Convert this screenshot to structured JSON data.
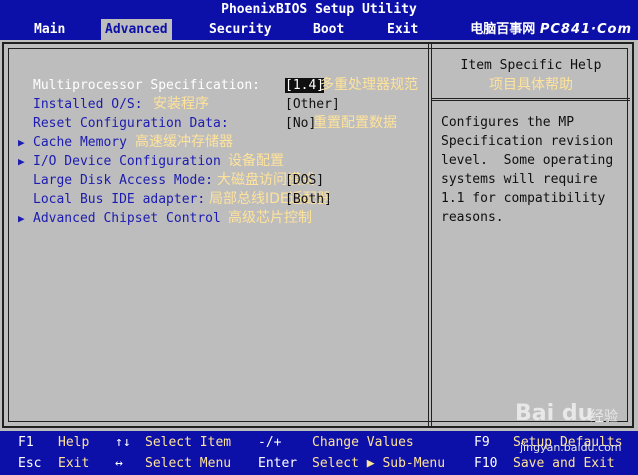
{
  "title": "PhoenixBIOS Setup Utility",
  "menu": {
    "tabs": [
      "Main",
      "Advanced",
      "Security",
      "Boot",
      "Exit"
    ],
    "active": "Advanced",
    "watermark_cn": "电脑百事网",
    "watermark_brand": "PC841·Com"
  },
  "items": [
    {
      "label": "Multiprocessor Specification:",
      "value": "[1.4]",
      "note_cn": "多重处理器规范",
      "submenu": false
    },
    {
      "label": "Installed O/S:",
      "note_cn": "安装程序",
      "value": "[Other]",
      "submenu": false
    },
    {
      "label": "Reset Configuration Data:",
      "value": "[No]",
      "note_cn": "重置配置数据",
      "submenu": false
    },
    {
      "label": "Cache Memory",
      "note_cn": "高速缓冲存储器",
      "submenu": true
    },
    {
      "label": "I/O Device Configuration",
      "note_cn": "设备配置",
      "submenu": true
    },
    {
      "label": "Large Disk Access Mode:",
      "note_cn": "大磁盘访问模式",
      "value": "[DOS]",
      "submenu": false
    },
    {
      "label": "Local Bus IDE adapter:",
      "note_cn": "局部总线IDE适配器",
      "value": "[Both]",
      "submenu": false
    },
    {
      "label": "Advanced Chipset Control",
      "note_cn": "高级芯片控制",
      "submenu": true
    }
  ],
  "help": {
    "title": "Item Specific Help",
    "title_cn": "项目具体帮助",
    "text": "Configures the MP\nSpecification revision\nlevel.  Some operating\nsystems will require\n1.1 for compatibility\nreasons."
  },
  "keys": [
    {
      "key": "F1",
      "action": "Help"
    },
    {
      "key": "↑↓",
      "action": "Select Item"
    },
    {
      "key": "-/+",
      "action": "Change Values"
    },
    {
      "key": "F9",
      "action": "Setup Defaults"
    },
    {
      "key": "Esc",
      "action": "Exit"
    },
    {
      "key": "↔",
      "action": "Select Menu"
    },
    {
      "key": "Enter",
      "action": "Select ▶ Sub-Menu"
    },
    {
      "key": "F10",
      "action": "Save and Exit"
    }
  ],
  "overlay": {
    "logo": "Bai du",
    "logo_cn": "经验",
    "url": "jingyan.baidu.com"
  },
  "colors": {
    "bios_blue": "#0c10a8",
    "panel_gray": "#bdbdbd",
    "label_blue": "#1c1cb0",
    "cn_yellow": "#ffe39a"
  }
}
